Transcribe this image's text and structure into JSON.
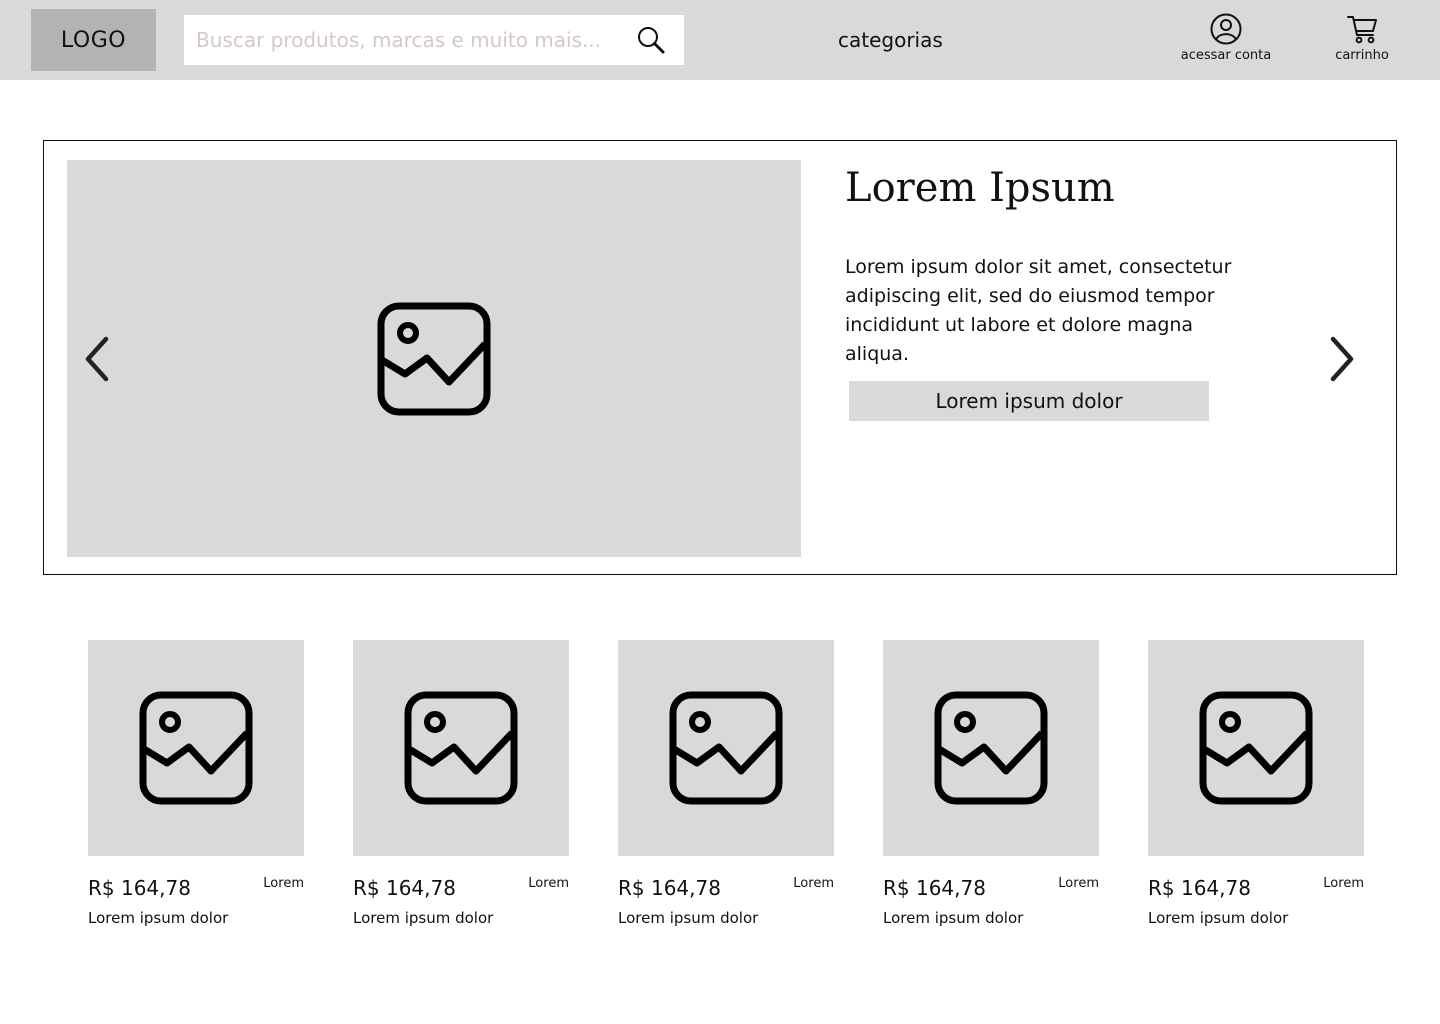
{
  "header": {
    "logo": "LOGO",
    "search": {
      "placeholder": "Buscar produtos, marcas e muito mais..."
    },
    "categories_label": "categorias",
    "account_label": "acessar conta",
    "cart_label": "carrinho",
    "icons": {
      "search": "search-icon",
      "account": "user-circle-icon",
      "cart": "cart-icon"
    }
  },
  "hero": {
    "title": "Lorem Ipsum",
    "text": "Lorem ipsum dolor sit amet, consectetur adipiscing elit, sed do eiusmod tempor incididunt ut labore et dolore magna aliqua.",
    "button_label": "Lorem ipsum dolor",
    "image_icon": "image-placeholder-icon",
    "prev_icon": "chevron-left-icon",
    "next_icon": "chevron-right-icon"
  },
  "products": [
    {
      "price": "R$ 164,78",
      "tag": "Lorem",
      "name": "Lorem ipsum dolor"
    },
    {
      "price": "R$ 164,78",
      "tag": "Lorem",
      "name": "Lorem ipsum dolor"
    },
    {
      "price": "R$ 164,78",
      "tag": "Lorem",
      "name": "Lorem ipsum dolor"
    },
    {
      "price": "R$ 164,78",
      "tag": "Lorem",
      "name": "Lorem ipsum dolor"
    },
    {
      "price": "R$ 164,78",
      "tag": "Lorem",
      "name": "Lorem ipsum dolor"
    }
  ],
  "colors": {
    "header_bg": "#d9d9d9",
    "logo_bg": "#b3b3b3",
    "placeholder_bg": "#d9d9d9",
    "placeholder_text": "#d4c8c8",
    "text": "#111111"
  }
}
